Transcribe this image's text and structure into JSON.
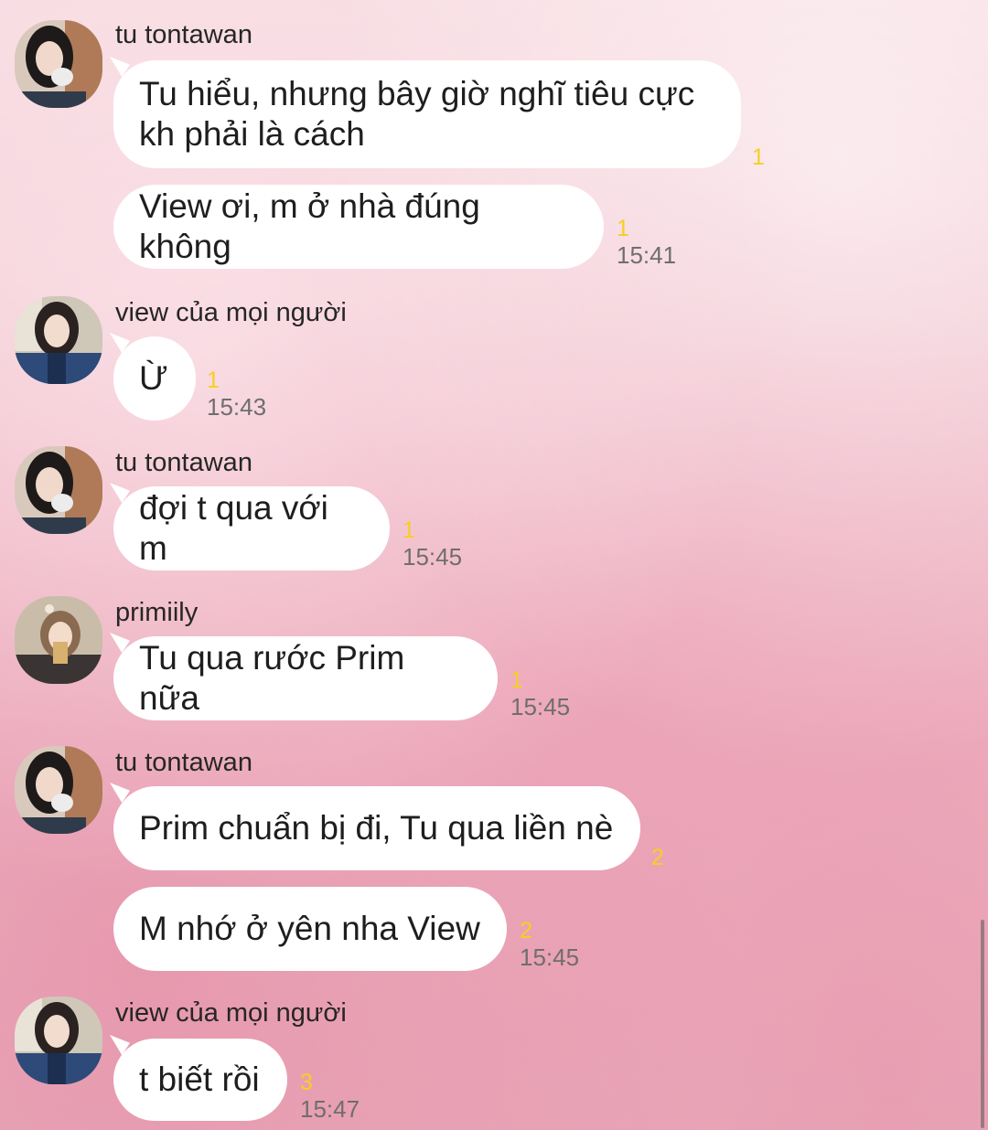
{
  "messages": [
    {
      "sender": "tu tontawan",
      "avatar_icon": "profile-photo-tu-tontawan",
      "bubbles": [
        {
          "text": "Tu hiểu, nhưng bây giờ nghĩ tiêu cực\nkh phải là cách",
          "unread": "1",
          "time": ""
        },
        {
          "text": "View ơi, m ở nhà đúng không",
          "unread": "1",
          "time": "15:41"
        }
      ]
    },
    {
      "sender": "view của mọi người",
      "avatar_icon": "profile-photo-view",
      "bubbles": [
        {
          "text": "Ừ",
          "unread": "1",
          "time": "15:43"
        }
      ]
    },
    {
      "sender": "tu tontawan",
      "avatar_icon": "profile-photo-tu-tontawan",
      "bubbles": [
        {
          "text": "đợi t qua với m",
          "unread": "1",
          "time": "15:45"
        }
      ]
    },
    {
      "sender": "primiily",
      "avatar_icon": "profile-photo-primiily",
      "bubbles": [
        {
          "text": "Tu qua rước Prim nữa",
          "unread": "1",
          "time": "15:45"
        }
      ]
    },
    {
      "sender": "tu tontawan",
      "avatar_icon": "profile-photo-tu-tontawan",
      "bubbles": [
        {
          "text": "Prim chuẩn bị đi, Tu qua liền nè",
          "unread": "2",
          "time": ""
        },
        {
          "text": "M nhớ ở yên nha View",
          "unread": "2",
          "time": "15:45"
        }
      ]
    },
    {
      "sender": "view của mọi người",
      "avatar_icon": "profile-photo-view",
      "bubbles": [
        {
          "text": "t biết rồi",
          "unread": "3",
          "time": "15:47"
        }
      ]
    }
  ],
  "colors": {
    "bubble": "#ffffff",
    "unread_count": "#f5d020",
    "timestamp": "#6e6e6e",
    "sender_name": "#262626"
  }
}
